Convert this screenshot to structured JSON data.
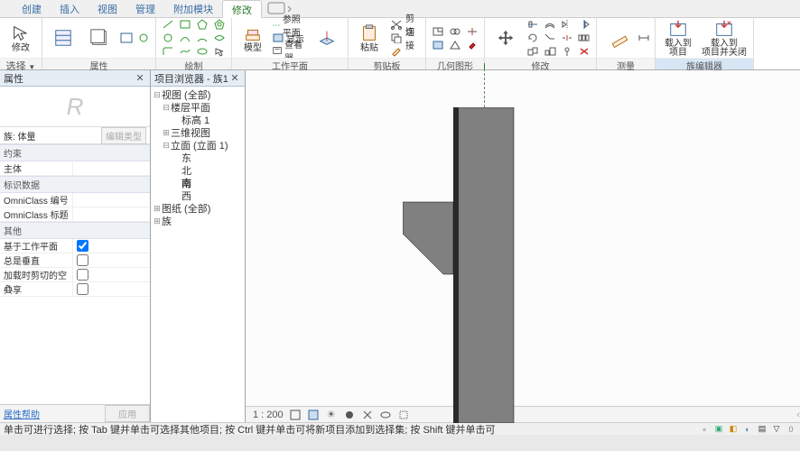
{
  "tabs": [
    "创建",
    "插入",
    "视图",
    "管理",
    "附加模块",
    "修改"
  ],
  "active_tab": 5,
  "ribbon": {
    "select": {
      "label": "选择",
      "btn": "修改"
    },
    "props": {
      "label": "属性"
    },
    "clipboard_top": {
      "label": "剪贴板",
      "paste": "粘贴"
    },
    "draw": {
      "label": "绘制"
    },
    "workplane": {
      "label": "工作平面",
      "model": "模型",
      "ref": "参照平面",
      "show": "显示",
      "viewer": "查看器"
    },
    "cut": {
      "label": "剪贴板",
      "cut": "剪切",
      "join": "连接"
    },
    "geom": {
      "label": "几何图形"
    },
    "modify": {
      "label": "修改"
    },
    "measure": {
      "label": "测量"
    },
    "familyeditor": {
      "label": "族编辑器",
      "load": "载入到\n项目",
      "loadclose": "载入到\n项目并关闭"
    }
  },
  "props_panel": {
    "title": "属性",
    "family_label": "族: 体量",
    "edit_type": "编辑类型",
    "sections": {
      "constraints": "约束",
      "iddata": "标识数据",
      "other": "其他"
    },
    "rows": {
      "host": {
        "k": "主体",
        "v": ""
      },
      "omni_num": {
        "k": "OmniClass 编号",
        "v": ""
      },
      "omni_title": {
        "k": "OmniClass 标题",
        "v": ""
      },
      "workplane": {
        "k": "基于工作平面",
        "checked": true
      },
      "vertical": {
        "k": "总是垂直",
        "checked": false
      },
      "cutvoid": {
        "k": "加载时剪切的空心",
        "checked": false
      },
      "shared": {
        "k": "共享",
        "checked": false
      }
    },
    "help": "属性帮助",
    "apply": "应用"
  },
  "browser": {
    "title": "项目浏览器 - 族1",
    "tree": [
      {
        "d": 1,
        "tgl": "⊟",
        "glyph": "",
        "txt": "视图 (全部)"
      },
      {
        "d": 2,
        "tgl": "⊟",
        "glyph": "",
        "txt": "楼层平面"
      },
      {
        "d": 3,
        "tgl": "",
        "glyph": "",
        "txt": "标高 1"
      },
      {
        "d": 2,
        "tgl": "⊞",
        "glyph": "",
        "txt": "三维视图"
      },
      {
        "d": 2,
        "tgl": "⊟",
        "glyph": "",
        "txt": "立面 (立面 1)"
      },
      {
        "d": 3,
        "tgl": "",
        "glyph": "",
        "txt": "东"
      },
      {
        "d": 3,
        "tgl": "",
        "glyph": "",
        "txt": "北"
      },
      {
        "d": 3,
        "tgl": "",
        "glyph": "",
        "txt": "南",
        "bold": true
      },
      {
        "d": 3,
        "tgl": "",
        "glyph": "",
        "txt": "西"
      },
      {
        "d": 1,
        "tgl": "⊞",
        "glyph": "",
        "txt": "图纸 (全部)"
      },
      {
        "d": 1,
        "tgl": "⊞",
        "glyph": "",
        "txt": "族"
      }
    ]
  },
  "viewbar": {
    "scale": "1 : 200"
  },
  "statusbar": {
    "text": "单击可进行选择; 按 Tab 键并单击可选择其他项目; 按 Ctrl 键并单击可将新项目添加到选择集; 按 Shift 键并单击可"
  }
}
